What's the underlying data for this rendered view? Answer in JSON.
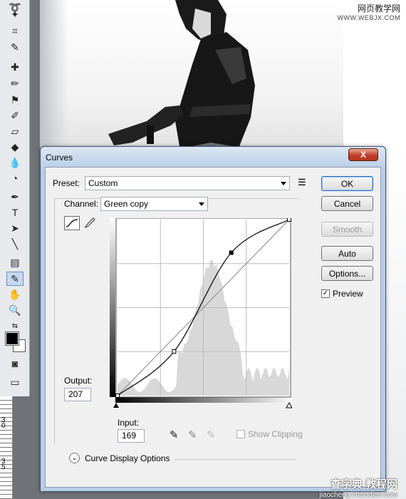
{
  "watermark": {
    "top_line1": "网页教学网",
    "top_line2": "WWW.WEBJX.COM",
    "bottom_line1": "查字典 教程网",
    "bottom_line2": "jiaocheng.chazidian.com"
  },
  "ruler": {
    "labels": [
      "3",
      "0",
      "3",
      "5"
    ]
  },
  "dialog": {
    "title": "Curves",
    "close_glyph": "X",
    "preset": {
      "label": "Preset:",
      "value": "Custom"
    },
    "channel": {
      "label": "Channel:",
      "value": "Green copy"
    },
    "output": {
      "label": "Output:",
      "value": "207"
    },
    "input": {
      "label": "Input:",
      "value": "169"
    },
    "show_clipping": {
      "label": "Show Clipping",
      "checked": false
    },
    "curve_display_options": "Curve Display Options",
    "buttons": {
      "ok": "OK",
      "cancel": "Cancel",
      "smooth": "Smooth",
      "auto": "Auto",
      "options": "Options..."
    },
    "preview": {
      "label": "Preview",
      "checked": true
    },
    "curve": {
      "input_range": [
        0,
        255
      ],
      "output_range": [
        0,
        255
      ],
      "points": [
        [
          0,
          0
        ],
        [
          84,
          64
        ],
        [
          169,
          207
        ],
        [
          255,
          255
        ]
      ],
      "selected_point": [
        169,
        207
      ]
    }
  },
  "colors": {
    "dialog_frame": "#b9cde4",
    "client_bg": "#f0f0f0",
    "close_button": "#c1402b",
    "histogram": "#d8d8d8"
  }
}
